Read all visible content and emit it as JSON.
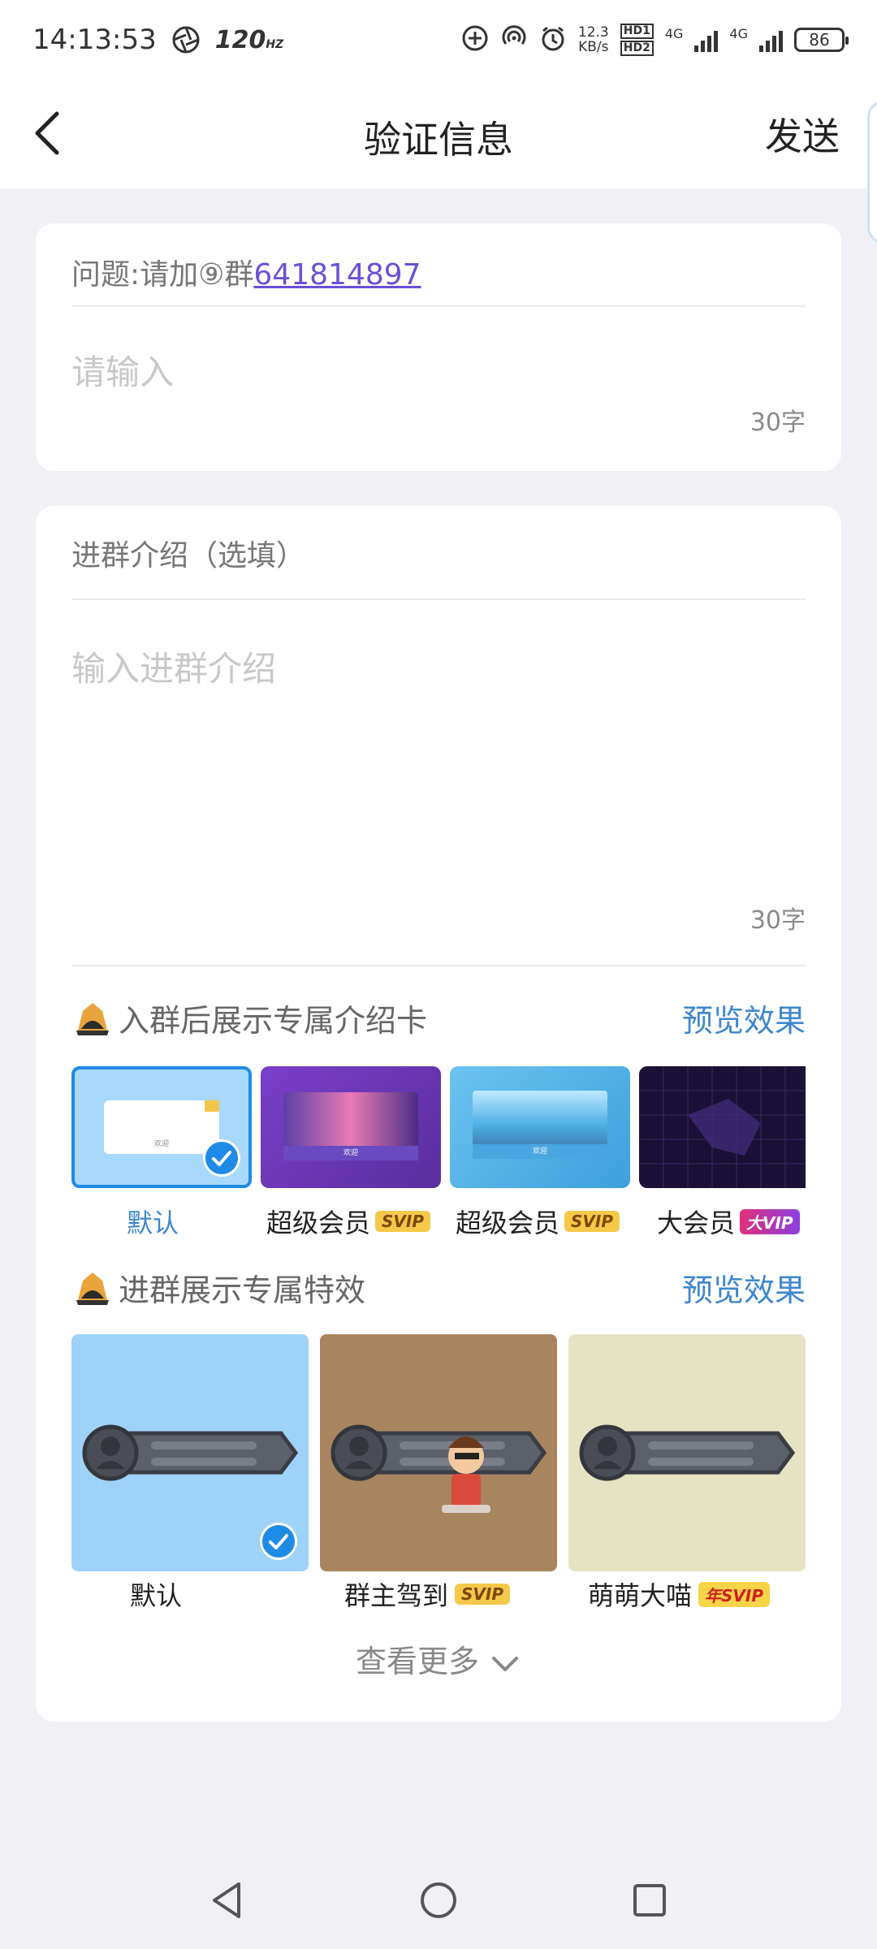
{
  "status_bar": {
    "time": "14:13:53",
    "refresh_rate": "120",
    "refresh_unit": "HZ",
    "speed_value": "12.3",
    "speed_unit": "KB/s",
    "hd1": "HD1",
    "hd2": "HD2",
    "net1": "4G",
    "net2": "4G",
    "battery": "86"
  },
  "nav": {
    "title": "验证信息",
    "send_label": "发送"
  },
  "question_card": {
    "question_prefix": "问题:请加⑨群",
    "question_link": "641814897",
    "answer_placeholder": "请输入",
    "answer_counter": "30字"
  },
  "intro_card": {
    "heading": "进群介绍（选填）",
    "intro_placeholder": "输入进群介绍",
    "intro_counter": "30字"
  },
  "intro_cards_section": {
    "title": "入群后展示专属介绍卡",
    "preview_label": "预览效果",
    "cards": [
      {
        "label": "默认",
        "badge": "",
        "card_text": "欢迎",
        "selected": true
      },
      {
        "label": "超级会员",
        "badge": "SVIP",
        "card_text": "欢迎",
        "selected": false
      },
      {
        "label": "超级会员",
        "badge": "SVIP",
        "card_text": "欢迎",
        "selected": false
      },
      {
        "label": "大会员",
        "badge": "VIP",
        "badge_prefix": "大",
        "card_text": "",
        "selected": false
      }
    ]
  },
  "effects_section": {
    "title": "进群展示专属特效",
    "preview_label": "预览效果",
    "items": [
      {
        "label": "默认",
        "badge": "",
        "bg": "#9fd2f8",
        "selected": true
      },
      {
        "label": "群主驾到",
        "badge": "SVIP",
        "bg": "#a8845f",
        "selected": false
      },
      {
        "label": "萌萌大喵",
        "badge": "SVIP",
        "badge_prefix": "年",
        "bg": "#e6e3c3",
        "selected": false
      }
    ],
    "more_label": "查看更多"
  },
  "colors": {
    "accent": "#3d86d1",
    "link": "#6b4fd8",
    "check": "#1e8be6",
    "page_bg": "#f0f0f5"
  }
}
